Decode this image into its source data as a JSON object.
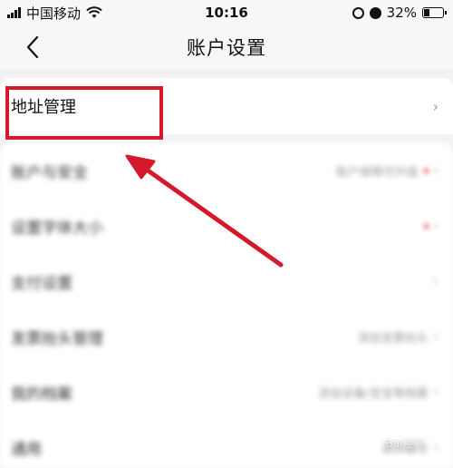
{
  "status_bar": {
    "carrier": "中国移动",
    "time": "10:16",
    "battery_percent": "32%",
    "battery_level": 0.32
  },
  "nav": {
    "title": "账户设置",
    "back_icon": "chevron-left-icon"
  },
  "address_row": {
    "label": "地址管理",
    "chevron": "›"
  },
  "settings": {
    "items": [
      {
        "label": "账户与安全",
        "value": "账户保障可升级",
        "dot": true
      },
      {
        "label": "设置字体大小",
        "value": "",
        "dot": true
      },
      {
        "label": "支付设置",
        "value": "",
        "dot": false
      },
      {
        "label": "发票抬头管理",
        "value": "添加发票抬头",
        "dot": false
      },
      {
        "label": "我的档案",
        "value": "添加设备/宝宝等档案",
        "dot": false
      },
      {
        "label": "通用",
        "value": "清除缓存",
        "dot": false
      }
    ],
    "chevron": "›"
  },
  "annotation": {
    "highlight_color": "#d4192b"
  },
  "watermark": {
    "text": "Bai经验"
  }
}
